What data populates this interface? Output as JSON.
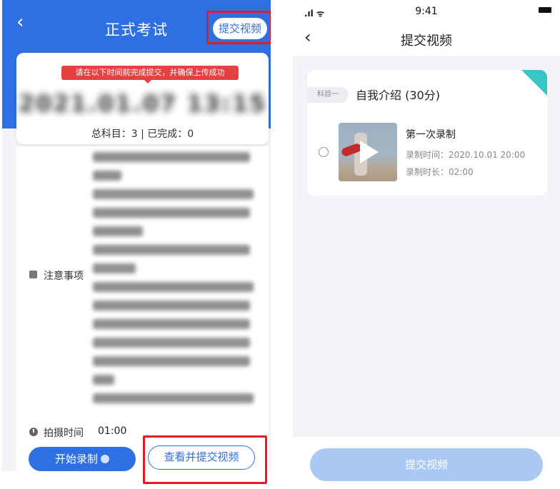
{
  "left_screen": {
    "nav": {
      "back_icon": "chevron-left-icon",
      "title": "正式考试",
      "submit_button": "提交视频"
    },
    "card": {
      "tip": "请在以下时间前完成提交，并确保上传成功",
      "deadline": "2021.01.07 13:15",
      "summary": "总科目：3 | 已完成：0"
    },
    "notes": {
      "label": "注意事项",
      "icon": "notice-icon"
    },
    "shoot": {
      "icon": "clock-icon",
      "label": "拍摄时间",
      "value": "01:00"
    },
    "actions": {
      "start_label": "开始录制",
      "view_submit_label": "查看并提交视频"
    },
    "highlight_color": "#e11d25",
    "accent_color": "#2f6fe4"
  },
  "right_screen": {
    "status": {
      "time": "9:41",
      "signal": ".ıl ᯤ"
    },
    "nav": {
      "back_icon": "chevron-left-icon",
      "title": "提交视频"
    },
    "subject": {
      "tag": "科目一",
      "title": "自我介绍 (30分)"
    },
    "recording": {
      "title": "第一次录制",
      "time": "录制时间：2020.10.01 20:00",
      "duration": "录制时长：02:00"
    },
    "submit_label": "提交视频",
    "submit_color": "#a9c8f4",
    "corner_color": "#36c7c5"
  }
}
